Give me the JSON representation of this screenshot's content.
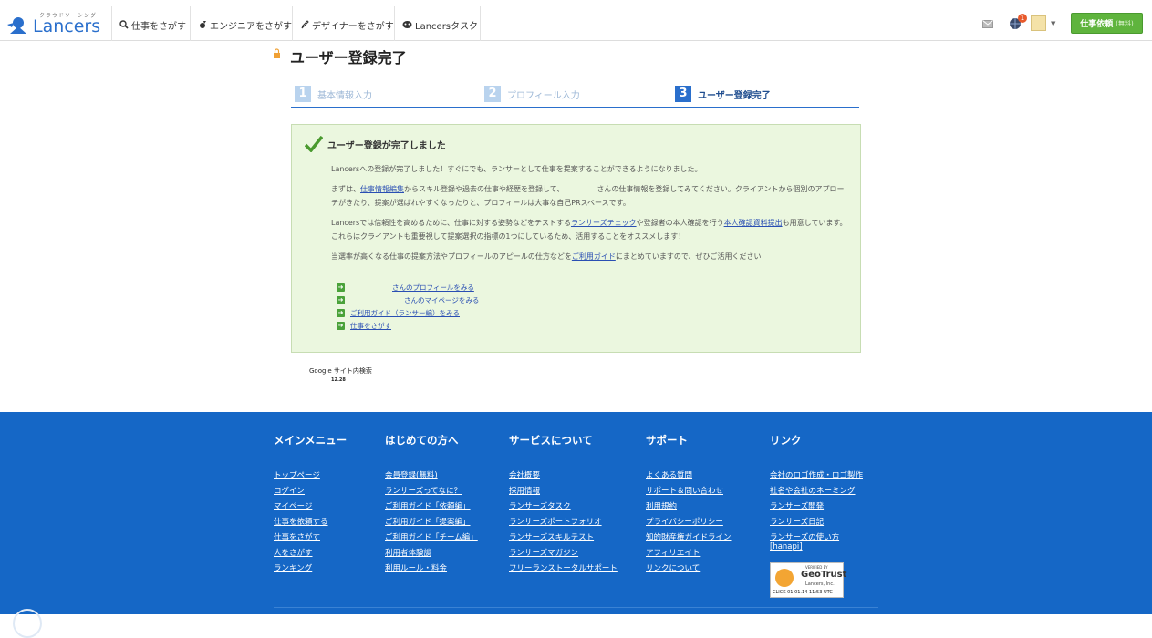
{
  "header": {
    "logo_tagline": "クラウドソーシング",
    "logo_text": "Lancers",
    "nav": [
      {
        "label": "仕事をさがす",
        "icon": "search-icon"
      },
      {
        "label": "エンジニアをさがす",
        "icon": "wrench-icon"
      },
      {
        "label": "デザイナーをさがす",
        "icon": "pen-icon"
      },
      {
        "label": "Lancersタスク",
        "icon": "task-icon"
      }
    ],
    "notification_count": "1",
    "request_button": "仕事依頼",
    "request_button_sub": "(無料)"
  },
  "page": {
    "title": "ユーザー登録完了",
    "steps": [
      {
        "num": "1",
        "label": "基本情報入力",
        "active": false
      },
      {
        "num": "2",
        "label": "プロフィール入力",
        "active": false
      },
      {
        "num": "3",
        "label": "ユーザー登録完了",
        "active": true
      }
    ]
  },
  "panel": {
    "heading": "ユーザー登録が完了しました",
    "p1": "Lancersへの登録が完了しました！すぐにでも、ランサーとして仕事を提案することができるようになりました。",
    "p2_a": "まずは、",
    "p2_link": "仕事情報編集",
    "p2_b": "からスキル登録や過去の仕事や経歴を登録して、　　　　　さんの仕事情報を登録してみてください。クライアントから個別のアプローチがきたり、提案が選ばれやすくなったりと、プロフィールは大事な自己PRスペースです。",
    "p3_a": "Lancersでは信頼性を高めるために、仕事に対する姿勢などをテストする",
    "p3_link1": "ランサーズチェック",
    "p3_b": "や登録者の本人確認を行う",
    "p3_link2": "本人確認資料提出",
    "p3_c": "も用意しています。これらはクライアントも重要視して提案選択の指標の1つにしているため、活用することをオススメします！",
    "p4_a": "当選率が高くなる仕事の提案方法やプロフィールのアピールの仕方などを",
    "p4_link": "ご利用ガイド",
    "p4_b": "にまとめていますので、ぜひご活用ください！",
    "links": [
      "さんのプロフィールをみる",
      "さんのマイページをみる",
      "ご利用ガイド（ランサー編）をみる",
      "仕事をさがす"
    ]
  },
  "google": {
    "label": "Google サイト内検索",
    "sub": "12.28"
  },
  "footer": {
    "columns": [
      {
        "title": "メインメニュー",
        "links": [
          "トップページ",
          "ログイン",
          "マイページ",
          "仕事を依頼する",
          "仕事をさがす",
          "人をさがす",
          "ランキング"
        ]
      },
      {
        "title": "はじめての方へ",
        "links": [
          "会員登録(無料)",
          "ランサーズってなに？",
          "ご利用ガイド「依頼編」",
          "ご利用ガイド「提案編」",
          "ご利用ガイド「チーム編」",
          "利用者体験談",
          "利用ルール・料金"
        ]
      },
      {
        "title": "サービスについて",
        "links": [
          "会社概要",
          "採用情報",
          "ランサーズタスク",
          "ランサーズポートフォリオ",
          "ランサーズスキルテスト",
          "ランサーズマガジン",
          "フリーランストータルサポート"
        ]
      },
      {
        "title": "サポート",
        "links": [
          "よくある質問",
          "サポート＆問い合わせ",
          "利用規約",
          "プライバシーポリシー",
          "知的財産権ガイドライン",
          "アフィリエイト",
          "リンクについて"
        ]
      },
      {
        "title": "リンク",
        "links": [
          "会社のロゴ作成・ロゴ製作",
          "社名や会社のネーミング",
          "ランサーズ開発",
          "ランサーズ日記",
          "ランサーズの使い方[hanapi]"
        ]
      }
    ],
    "geotrust": {
      "verified": "VERIFIED BY",
      "brand": "GeoTrust",
      "company": "Lancers, Inc.",
      "date": "CLICK 01.01.14 11:53 UTC"
    }
  }
}
